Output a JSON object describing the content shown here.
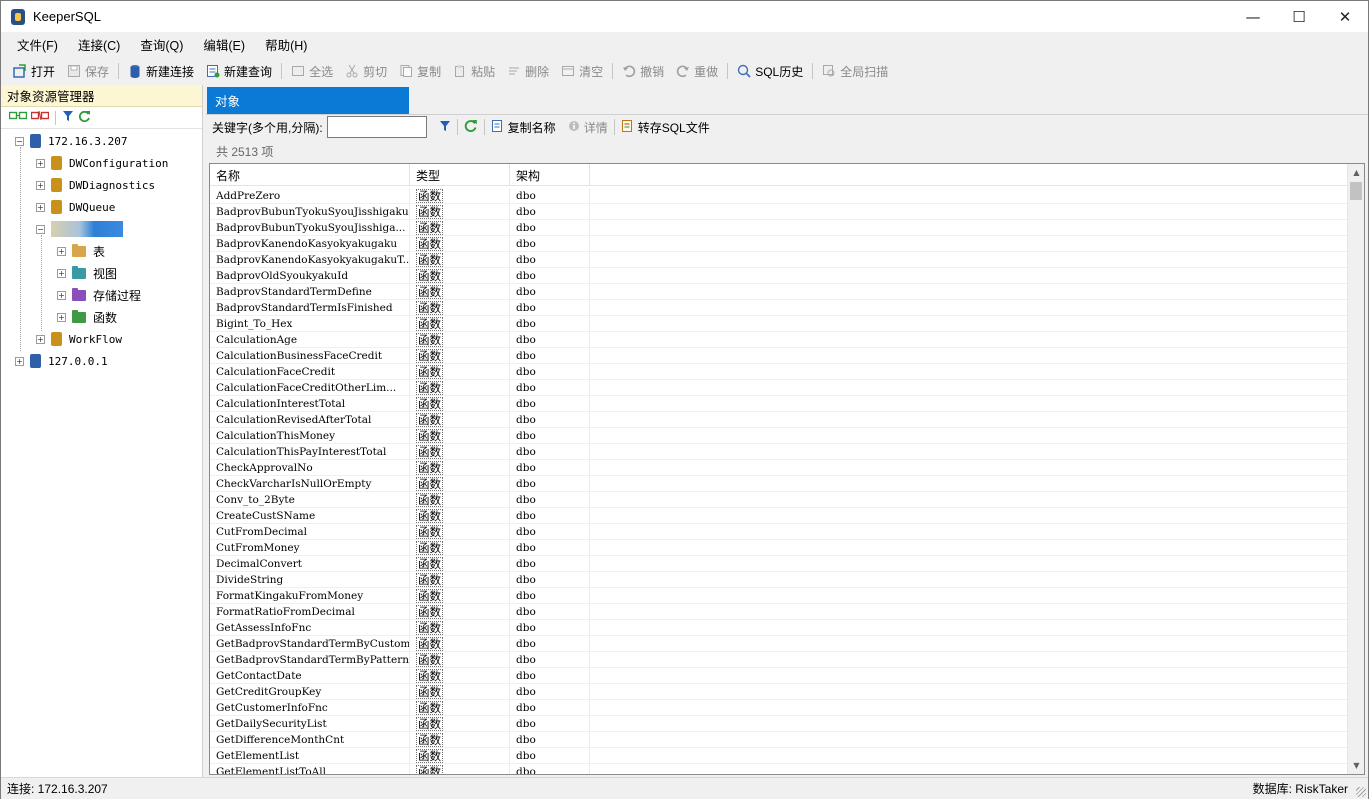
{
  "window": {
    "title": "KeeperSQL",
    "controls": [
      "—",
      "☐",
      "✕"
    ]
  },
  "menu": [
    {
      "label": "文件(F)"
    },
    {
      "label": "连接(C)"
    },
    {
      "label": "查询(Q)"
    },
    {
      "label": "编辑(E)"
    },
    {
      "label": "帮助(H)"
    }
  ],
  "toolbar": {
    "open": "打开",
    "save": "保存",
    "new_connection": "新建连接",
    "new_query": "新建查询",
    "select_all": "全选",
    "cut": "剪切",
    "copy": "复制",
    "paste": "粘贴",
    "delete": "删除",
    "clear": "清空",
    "undo": "撤销",
    "redo": "重做",
    "sql_history": "SQL历史",
    "global_scan": "全局扫描"
  },
  "explorer": {
    "title": "对象资源管理器",
    "tree": {
      "server1": "172.16.3.207",
      "db1": "DWConfiguration",
      "db2": "DWDiagnostics",
      "db3": "DWQueue",
      "folder_tables": "表",
      "folder_views": "视图",
      "folder_procs": "存储过程",
      "folder_funcs": "函数",
      "db5": "WorkFlow",
      "server2": "127.0.0.1"
    }
  },
  "objects": {
    "tab": "对象",
    "keyword_label": "关键字(多个用,分隔):",
    "keyword_value": "",
    "copy_name": "复制名称",
    "details": "详情",
    "to_sql_file": "转存SQL文件",
    "count": "共 2513 项",
    "columns": {
      "name": "名称",
      "type": "类型",
      "schema": "架构"
    },
    "rows": [
      [
        "AddPreZero",
        "函数",
        "dbo"
      ],
      [
        "BadprovBubunTyokuSyouJisshigaku",
        "函数",
        "dbo"
      ],
      [
        "BadprovBubunTyokuSyouJisshiga...",
        "函数",
        "dbo"
      ],
      [
        "BadprovKanendoKasyokyakugaku",
        "函数",
        "dbo"
      ],
      [
        "BadprovKanendoKasyokyakugakuT...",
        "函数",
        "dbo"
      ],
      [
        "BadprovOldSyoukyakuId",
        "函数",
        "dbo"
      ],
      [
        "BadprovStandardTermDefine",
        "函数",
        "dbo"
      ],
      [
        "BadprovStandardTermIsFinished",
        "函数",
        "dbo"
      ],
      [
        "Bigint_To_Hex",
        "函数",
        "dbo"
      ],
      [
        "CalculationAge",
        "函数",
        "dbo"
      ],
      [
        "CalculationBusinessFaceCredit",
        "函数",
        "dbo"
      ],
      [
        "CalculationFaceCredit",
        "函数",
        "dbo"
      ],
      [
        "CalculationFaceCreditOtherLim...",
        "函数",
        "dbo"
      ],
      [
        "CalculationInterestTotal",
        "函数",
        "dbo"
      ],
      [
        "CalculationRevisedAfterTotal",
        "函数",
        "dbo"
      ],
      [
        "CalculationThisMoney",
        "函数",
        "dbo"
      ],
      [
        "CalculationThisPayInterestTotal",
        "函数",
        "dbo"
      ],
      [
        "CheckApprovalNo",
        "函数",
        "dbo"
      ],
      [
        "CheckVarcharIsNullOrEmpty",
        "函数",
        "dbo"
      ],
      [
        "Conv_to_2Byte",
        "函数",
        "dbo"
      ],
      [
        "CreateCustSName",
        "函数",
        "dbo"
      ],
      [
        "CutFromDecimal",
        "函数",
        "dbo"
      ],
      [
        "CutFromMoney",
        "函数",
        "dbo"
      ],
      [
        "DecimalConvert",
        "函数",
        "dbo"
      ],
      [
        "DivideString",
        "函数",
        "dbo"
      ],
      [
        "FormatKingakuFromMoney",
        "函数",
        "dbo"
      ],
      [
        "FormatRatioFromDecimal",
        "函数",
        "dbo"
      ],
      [
        "GetAssessInfoFnc",
        "函数",
        "dbo"
      ],
      [
        "GetBadprovStandardTermByCustomer",
        "函数",
        "dbo"
      ],
      [
        "GetBadprovStandardTermByPattern",
        "函数",
        "dbo"
      ],
      [
        "GetContactDate",
        "函数",
        "dbo"
      ],
      [
        "GetCreditGroupKey",
        "函数",
        "dbo"
      ],
      [
        "GetCustomerInfoFnc",
        "函数",
        "dbo"
      ],
      [
        "GetDailySecurityList",
        "函数",
        "dbo"
      ],
      [
        "GetDifferenceMonthCnt",
        "函数",
        "dbo"
      ],
      [
        "GetElementList",
        "函数",
        "dbo"
      ],
      [
        "GetElementListToAll",
        "函数",
        "dbo"
      ]
    ]
  },
  "status": {
    "connection": "连接: 172.16.3.207",
    "database": "数据库: RiskTaker"
  }
}
